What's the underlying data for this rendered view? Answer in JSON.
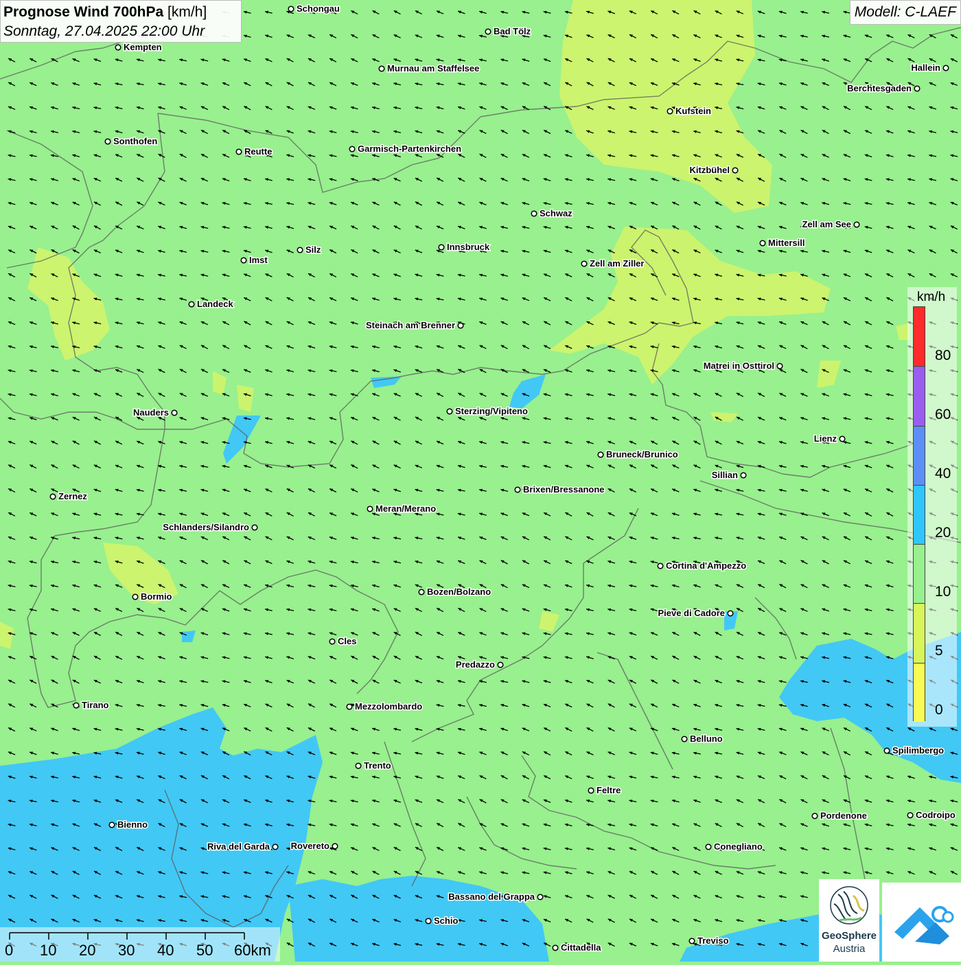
{
  "header": {
    "title": "Prognose Wind 700hPa",
    "unit": "[km/h]",
    "datetime": "Sonntag, 27.04.2025 22:00 Uhr"
  },
  "model": "Modell: C-LAEF",
  "legend": {
    "unit": "km/h",
    "labels": [
      "80",
      "60",
      "40",
      "20",
      "10",
      "5",
      "0"
    ],
    "colors": [
      "#ff2a2a",
      "#9b5cf0",
      "#5b8ff5",
      "#30c6fb",
      "#98f08e",
      "#d8f55a",
      "#fafa55"
    ]
  },
  "wind_arrows": {
    "direction": "from south-east, pointing north-west",
    "color": "#000000"
  },
  "colors": {
    "background": "#98f08e",
    "low_wind": "#d2f46a",
    "high_wind": "#42c8f5",
    "border": "#555555"
  },
  "scale_bar": {
    "labels": [
      "0",
      "10",
      "20",
      "30",
      "40",
      "50",
      "60km"
    ]
  },
  "cities": [
    {
      "name": "Schongau"
    },
    {
      "name": "Bad Tölz"
    },
    {
      "name": "Kempten"
    },
    {
      "name": "Murnau am Staffelsee"
    },
    {
      "name": "Hallein"
    },
    {
      "name": "Berchtesgaden"
    },
    {
      "name": "Kufstein"
    },
    {
      "name": "Sonthofen"
    },
    {
      "name": "Reutte"
    },
    {
      "name": "Garmisch-Partenkirchen"
    },
    {
      "name": "Kitzbühel"
    },
    {
      "name": "Schwaz"
    },
    {
      "name": "Zell am See"
    },
    {
      "name": "Mittersill"
    },
    {
      "name": "Innsbruck"
    },
    {
      "name": "Silz"
    },
    {
      "name": "Imst"
    },
    {
      "name": "Zell am Ziller"
    },
    {
      "name": "Landeck"
    },
    {
      "name": "Steinach am Brenner"
    },
    {
      "name": "Matrei in Osttirol"
    },
    {
      "name": "Nauders"
    },
    {
      "name": "Sterzing/Vipiteno"
    },
    {
      "name": "Lienz"
    },
    {
      "name": "Bruneck/Brunico"
    },
    {
      "name": "Sillian"
    },
    {
      "name": "Zernez"
    },
    {
      "name": "Brixen/Bressanone"
    },
    {
      "name": "Meran/Merano"
    },
    {
      "name": "Schlanders/Silandro"
    },
    {
      "name": "Cortina d'Ampezzo"
    },
    {
      "name": "Bozen/Bolzano"
    },
    {
      "name": "Bormio"
    },
    {
      "name": "Pieve di Cadore"
    },
    {
      "name": "Cles"
    },
    {
      "name": "Predazzo"
    },
    {
      "name": "Tirano"
    },
    {
      "name": "Mezzolombardo"
    },
    {
      "name": "Belluno"
    },
    {
      "name": "Spilimbergo"
    },
    {
      "name": "Trento"
    },
    {
      "name": "Feltre"
    },
    {
      "name": "Pordenone"
    },
    {
      "name": "Codroipo"
    },
    {
      "name": "Bienno"
    },
    {
      "name": "Riva del Garda"
    },
    {
      "name": "Rovereto"
    },
    {
      "name": "Conegliano"
    },
    {
      "name": "Bassano del Grappa"
    },
    {
      "name": "Schio"
    },
    {
      "name": "Treviso"
    },
    {
      "name": "Cittadella"
    }
  ],
  "logos": {
    "geosphere_name": "GeoSphere",
    "geosphere_sub": "Austria"
  }
}
